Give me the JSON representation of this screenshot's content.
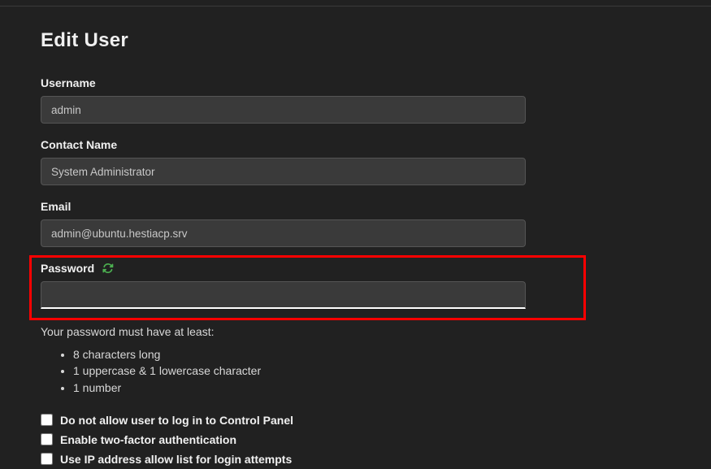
{
  "page": {
    "title": "Edit User"
  },
  "fields": {
    "username": {
      "label": "Username",
      "value": "admin"
    },
    "contactName": {
      "label": "Contact Name",
      "value": "System Administrator"
    },
    "email": {
      "label": "Email",
      "value": "admin@ubuntu.hestiacp.srv"
    },
    "password": {
      "label": "Password",
      "value": ""
    }
  },
  "passwordHelp": {
    "intro": "Your password must have at least:",
    "req1": "8 characters long",
    "req2": "1 uppercase & 1 lowercase character",
    "req3": "1 number"
  },
  "options": {
    "disallowLogin": {
      "label": "Do not allow user to log in to Control Panel"
    },
    "twoFactor": {
      "label": "Enable two-factor authentication"
    },
    "ipAllowList": {
      "label": "Use IP address allow list for login attempts"
    }
  },
  "colors": {
    "accent": "#4caf50",
    "highlight": "#ff0000"
  }
}
